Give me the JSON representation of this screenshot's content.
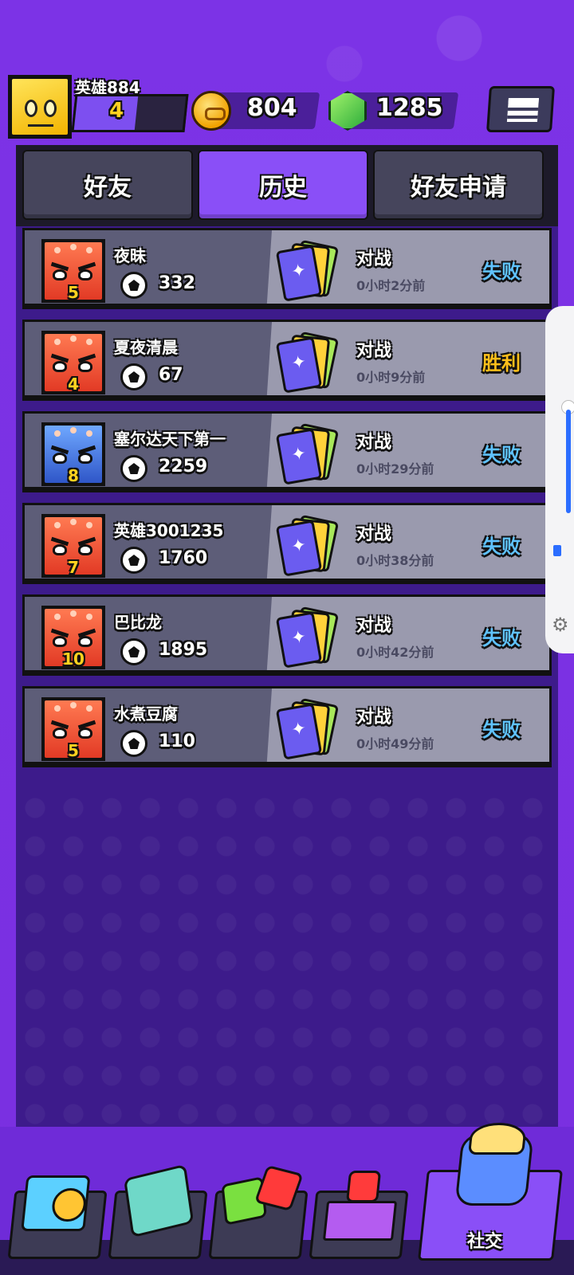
{
  "player": {
    "name": "英雄884",
    "level": "4"
  },
  "currency": {
    "coins": "804",
    "gems": "1285"
  },
  "tabs": [
    {
      "label": "好友",
      "active": false
    },
    {
      "label": "历史",
      "active": true
    },
    {
      "label": "好友申请",
      "active": false
    }
  ],
  "history": [
    {
      "name": "夜昧",
      "level": "5",
      "score": "332",
      "type": "对战",
      "time": "0小时2分前",
      "result": "失败",
      "outcome": "lose",
      "avatar": "red"
    },
    {
      "name": "夏夜清晨",
      "level": "4",
      "score": "67",
      "type": "对战",
      "time": "0小时9分前",
      "result": "胜利",
      "outcome": "win",
      "avatar": "red"
    },
    {
      "name": "塞尔达天下第一",
      "level": "8",
      "score": "2259",
      "type": "对战",
      "time": "0小时29分前",
      "result": "失败",
      "outcome": "lose",
      "avatar": "blue"
    },
    {
      "name": "英雄3001235",
      "level": "7",
      "score": "1760",
      "type": "对战",
      "time": "0小时38分前",
      "result": "失败",
      "outcome": "lose",
      "avatar": "red"
    },
    {
      "name": "巴比龙",
      "level": "10",
      "score": "1895",
      "type": "对战",
      "time": "0小时42分前",
      "result": "失败",
      "outcome": "lose",
      "avatar": "red"
    },
    {
      "name": "水煮豆腐",
      "level": "5",
      "score": "110",
      "type": "对战",
      "time": "0小时49分前",
      "result": "失败",
      "outcome": "lose",
      "avatar": "red"
    }
  ],
  "nav": {
    "items": [
      {
        "icon": "shop-icon"
      },
      {
        "icon": "mail-robot-icon"
      },
      {
        "icon": "dice-battle-icon"
      },
      {
        "icon": "podium-ranking-icon"
      },
      {
        "icon": "social-icon",
        "label": "社交",
        "active": true
      }
    ]
  },
  "colors": {
    "background": "#7a2fe0",
    "panel": "#3d1b8b",
    "tab_active": "#8a4ff7",
    "result_lose": "#5fc2ff",
    "result_win": "#ffbf1a"
  }
}
